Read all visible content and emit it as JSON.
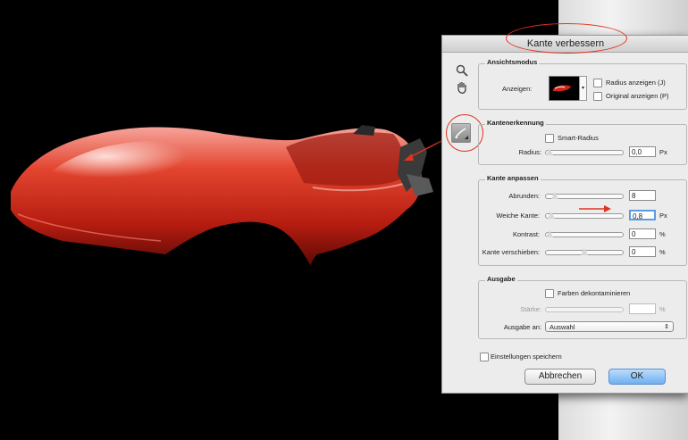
{
  "dialog": {
    "title": "Kante verbessern",
    "tools": {
      "zoom": "zoom-icon",
      "hand": "hand-icon",
      "refine": "refine-radius-brush-icon"
    },
    "ansichtsmodus": {
      "title": "Ansichtsmodus",
      "anzeigen_label": "Anzeigen:",
      "radius_anzeigen": "Radius anzeigen (J)",
      "original_anzeigen": "Original anzeigen (P)"
    },
    "kantenerkennung": {
      "title": "Kantenerkennung",
      "smart_radius": "Smart-Radius",
      "radius_label": "Radius:",
      "radius_value": "0,0",
      "radius_unit": "Px",
      "radius_level": 0.0
    },
    "kante_anpassen": {
      "title": "Kante anpassen",
      "rows": [
        {
          "label": "Abrunden:",
          "value": "8",
          "unit": "",
          "level": 0.08
        },
        {
          "label": "Weiche Kante:",
          "value": "0,8",
          "unit": "Px",
          "level": 0.02
        },
        {
          "label": "Kontrast:",
          "value": "0",
          "unit": "%",
          "level": 0.0
        },
        {
          "label": "Kante verschieben:",
          "value": "0",
          "unit": "%",
          "level": 0.5
        }
      ]
    },
    "ausgabe": {
      "title": "Ausgabe",
      "farben": "Farben dekontaminieren",
      "staerke_label": "Stärke:",
      "staerke_unit": "%",
      "ausgabe_an_label": "Ausgabe an:",
      "ausgabe_an_value": "Auswahl"
    },
    "einstellungen": "Einstellungen speichern",
    "cancel": "Abbrechen",
    "ok": "OK"
  },
  "colors": {
    "annotation": "#e2331f",
    "car_red": "#d0281a",
    "ok_blue": "#6fb0f1"
  }
}
